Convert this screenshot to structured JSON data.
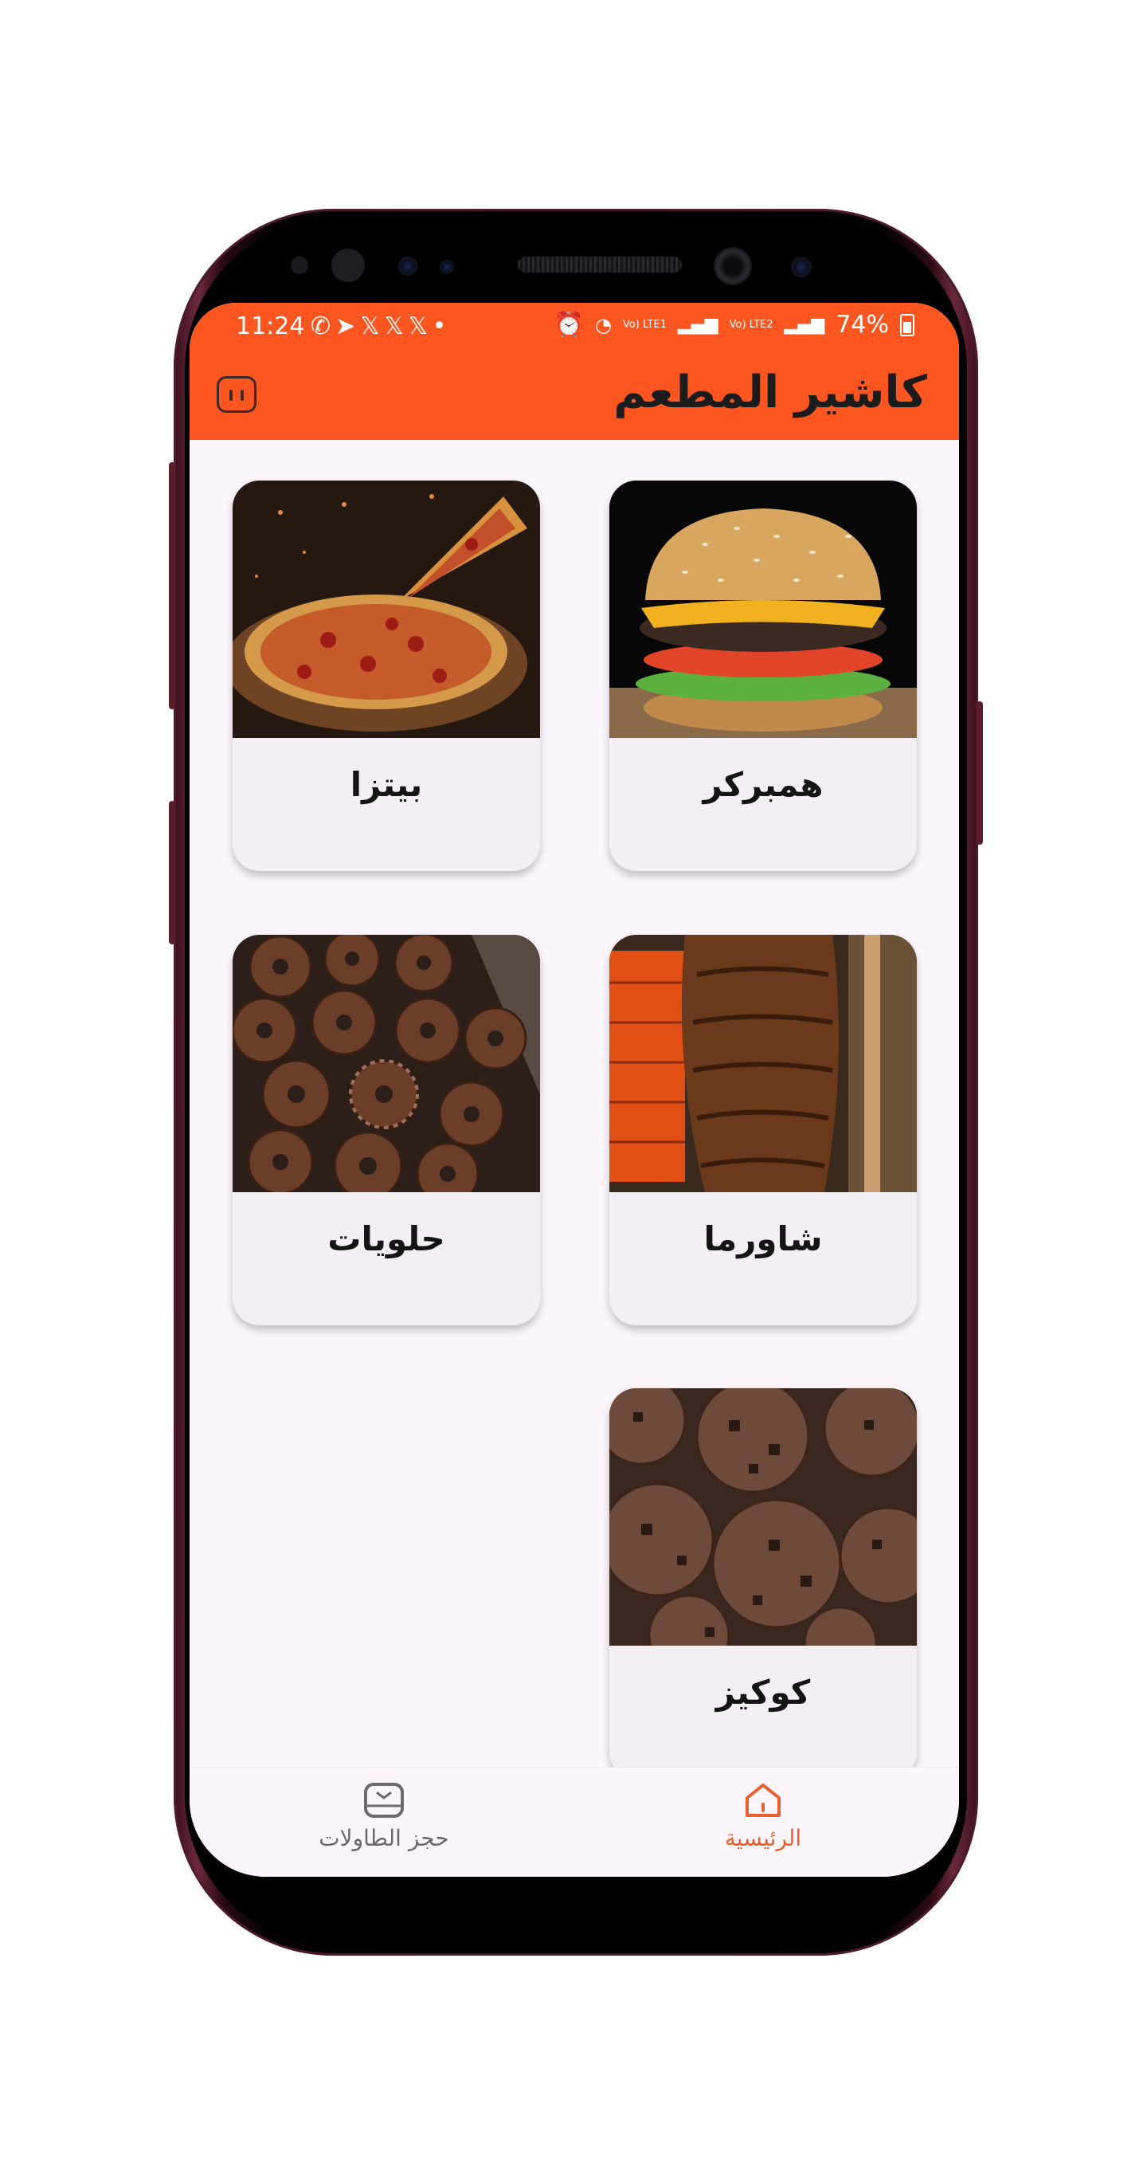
{
  "status_bar": {
    "time": "11:24",
    "notification_icons": [
      "whatsapp-icon",
      "telegram-icon",
      "x-icon",
      "x-icon",
      "x-icon",
      "dot-icon"
    ],
    "notification_glyphs": "✆➤𝕏𝕏𝕏•",
    "signal_1_label": "Vo) LTE1",
    "signal_2_label": "Vo) LTE2",
    "battery": "74%"
  },
  "app_bar": {
    "title": "كاشير المطعم",
    "action_icon": "feedback-icon"
  },
  "categories": [
    {
      "label": "همبركر",
      "image": "burger"
    },
    {
      "label": "بيتزا",
      "image": "pizza"
    },
    {
      "label": "شاورما",
      "image": "shawarma"
    },
    {
      "label": "حلويات",
      "image": "donuts"
    },
    {
      "label": "كوكيز",
      "image": "cookies"
    }
  ],
  "bottom_nav": {
    "items": [
      {
        "label": "الرئيسية",
        "icon": "home-icon",
        "active": true
      },
      {
        "label": "حجز الطاولات",
        "icon": "table-booking-icon",
        "active": false
      }
    ]
  },
  "colors": {
    "accent": "#fe5620",
    "background": "#fcf5fc",
    "card": "#f3eff4",
    "nav_active": "#e9602f",
    "nav_inactive": "#6b6a6f"
  }
}
